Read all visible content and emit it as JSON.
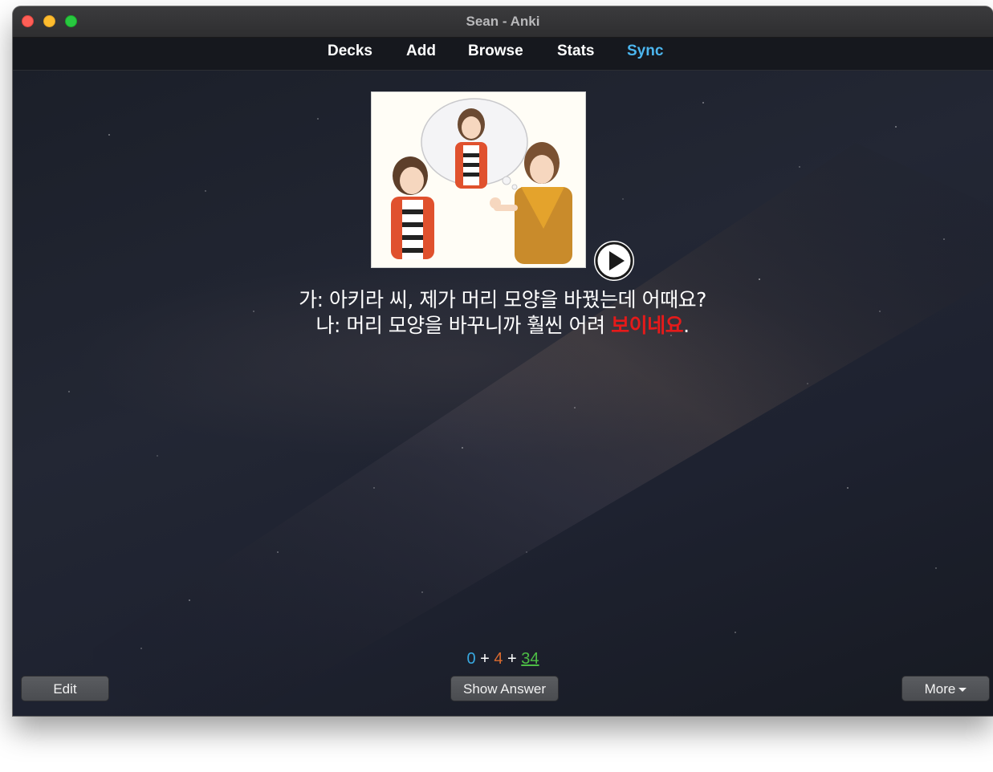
{
  "window": {
    "title": "Sean - Anki"
  },
  "toolbar": {
    "decks": "Decks",
    "add": "Add",
    "browse": "Browse",
    "stats": "Stats",
    "sync": "Sync",
    "sync_color": "#4cb6ef"
  },
  "card": {
    "image_icon": "illustration-image",
    "play_icon": "play-icon",
    "line1": "가: 아키라 씨, 제가 머리 모양을 바꿨는데 어때요?",
    "line2_prefix": "나: 머리 모양을 바꾸니까 훨씬 어려 ",
    "line2_highlight": "보이네요",
    "line2_suffix": ".",
    "highlight_color": "#e51a1a"
  },
  "counts": {
    "new": "0",
    "plus1": " + ",
    "learn": "4",
    "plus2": " + ",
    "review": "34",
    "new_color": "#38a8e0",
    "learn_color": "#d96a2f",
    "review_color": "#4dbd45"
  },
  "bottom_bar": {
    "edit": "Edit",
    "show_answer": "Show Answer",
    "more": "More"
  }
}
